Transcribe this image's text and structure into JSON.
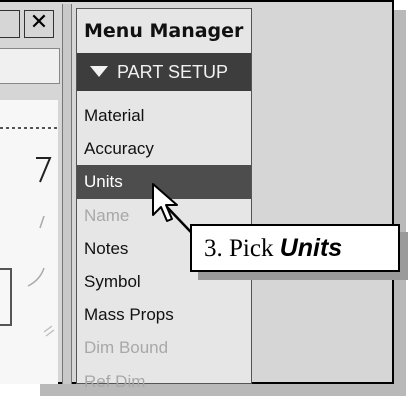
{
  "window_buttons": {
    "close_glyph": "✕"
  },
  "menu_manager": {
    "title": "Menu Manager",
    "section": "PART SETUP",
    "section_icon": "triangle-down-icon",
    "items": [
      {
        "label": "Material",
        "state": "normal"
      },
      {
        "label": "Accuracy",
        "state": "normal"
      },
      {
        "label": "Units",
        "state": "selected"
      },
      {
        "label": "Name",
        "state": "disabled"
      },
      {
        "label": "Notes",
        "state": "normal"
      },
      {
        "label": "Symbol",
        "state": "normal"
      },
      {
        "label": "Mass Props",
        "state": "normal"
      },
      {
        "label": "Dim Bound",
        "state": "disabled"
      },
      {
        "label": "Ref Dim",
        "state": "disabled"
      }
    ]
  },
  "callout": {
    "prefix": "3. Pick ",
    "emphasis": "Units"
  },
  "colors": {
    "selected_bg": "#4d4d4d",
    "header_bg": "#3d3d3d",
    "disabled_text": "#a8a8a8"
  }
}
